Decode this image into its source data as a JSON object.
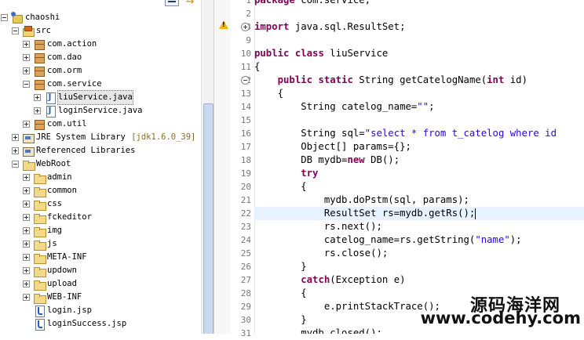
{
  "tree": {
    "items": [
      {
        "label": "chaoshi",
        "icon": "project-icon",
        "exp": "minus"
      },
      {
        "label": "src",
        "icon": "source-folder-icon",
        "exp": "minus"
      },
      {
        "label": "com.action",
        "icon": "package-icon",
        "exp": "plus"
      },
      {
        "label": "com.dao",
        "icon": "package-icon",
        "exp": "plus"
      },
      {
        "label": "com.orm",
        "icon": "package-icon",
        "exp": "plus"
      },
      {
        "label": "com.service",
        "icon": "package-icon",
        "exp": "minus"
      },
      {
        "label": "liuService.java",
        "icon": "java-file-icon",
        "exp": "plus",
        "selected": true
      },
      {
        "label": "loginService.java",
        "icon": "java-file-icon",
        "exp": "plus"
      },
      {
        "label": "com.util",
        "icon": "package-icon",
        "exp": "plus"
      },
      {
        "label": "JRE System Library",
        "suffix": "[jdk1.6.0_39]",
        "icon": "library-icon",
        "exp": "plus"
      },
      {
        "label": "Referenced Libraries",
        "icon": "library-icon",
        "exp": "plus"
      },
      {
        "label": "WebRoot",
        "icon": "folder-icon",
        "exp": "minus"
      },
      {
        "label": "admin",
        "icon": "folder-icon",
        "exp": "plus"
      },
      {
        "label": "common",
        "icon": "folder-icon",
        "exp": "plus"
      },
      {
        "label": "css",
        "icon": "folder-icon",
        "exp": "plus"
      },
      {
        "label": "fckeditor",
        "icon": "folder-icon",
        "exp": "plus"
      },
      {
        "label": "img",
        "icon": "folder-icon",
        "exp": "plus"
      },
      {
        "label": "js",
        "icon": "folder-icon",
        "exp": "plus"
      },
      {
        "label": "META-INF",
        "icon": "folder-icon",
        "exp": "plus"
      },
      {
        "label": "updown",
        "icon": "folder-icon",
        "exp": "plus"
      },
      {
        "label": "upload",
        "icon": "folder-icon",
        "exp": "plus"
      },
      {
        "label": "WEB-INF",
        "icon": "folder-icon",
        "exp": "plus"
      },
      {
        "label": "login.jsp",
        "icon": "jsp-file-icon",
        "exp": "none"
      },
      {
        "label": "loginSuccess.jsp",
        "icon": "jsp-file-icon",
        "exp": "none"
      }
    ]
  },
  "editor": {
    "current_line": 22,
    "lines": [
      {
        "n": "1",
        "fold": "",
        "t": [
          {
            "k": "kw",
            "s": "package"
          },
          {
            "s": " com.service;"
          }
        ]
      },
      {
        "n": "2",
        "fold": "",
        "t": []
      },
      {
        "n": "3",
        "fold": "plus",
        "t": [
          {
            "k": "kw",
            "s": "import"
          },
          {
            "s": " java.sql.ResultSet;"
          }
        ]
      },
      {
        "n": "9",
        "fold": "",
        "t": []
      },
      {
        "n": "10",
        "fold": "",
        "t": [
          {
            "k": "kw",
            "s": "public"
          },
          {
            "s": " "
          },
          {
            "k": "kw",
            "s": "class"
          },
          {
            "s": " liuService"
          }
        ]
      },
      {
        "n": "11",
        "fold": "",
        "t": [
          {
            "s": "{"
          }
        ]
      },
      {
        "n": "12",
        "fold": "minus",
        "t": [
          {
            "s": "    "
          },
          {
            "k": "kw",
            "s": "public"
          },
          {
            "s": " "
          },
          {
            "k": "kw",
            "s": "static"
          },
          {
            "s": " String getCatelogName("
          },
          {
            "k": "kw",
            "s": "int"
          },
          {
            "s": " id)"
          }
        ]
      },
      {
        "n": "13",
        "fold": "",
        "t": [
          {
            "s": "    {"
          }
        ]
      },
      {
        "n": "14",
        "fold": "",
        "t": [
          {
            "s": "        String catelog_name="
          },
          {
            "k": "st",
            "s": "\"\""
          },
          {
            "s": ";"
          }
        ]
      },
      {
        "n": "15",
        "fold": "",
        "t": []
      },
      {
        "n": "16",
        "fold": "",
        "t": [
          {
            "s": "        String sql="
          },
          {
            "k": "st",
            "s": "\"select * from t_catelog where id"
          }
        ]
      },
      {
        "n": "17",
        "fold": "",
        "t": [
          {
            "s": "        Object[] params={};"
          }
        ]
      },
      {
        "n": "18",
        "fold": "",
        "t": [
          {
            "s": "        DB mydb="
          },
          {
            "k": "kw",
            "s": "new"
          },
          {
            "s": " DB();"
          }
        ]
      },
      {
        "n": "19",
        "fold": "",
        "t": [
          {
            "s": "        "
          },
          {
            "k": "kw",
            "s": "try"
          }
        ]
      },
      {
        "n": "20",
        "fold": "",
        "t": [
          {
            "s": "        {"
          }
        ]
      },
      {
        "n": "21",
        "fold": "",
        "t": [
          {
            "s": "            mydb.doPstm(sql, params);"
          }
        ]
      },
      {
        "n": "22",
        "fold": "",
        "t": [
          {
            "s": "            ResultSet rs=mydb.getRs();"
          }
        ]
      },
      {
        "n": "23",
        "fold": "",
        "t": [
          {
            "s": "            rs.next();"
          }
        ]
      },
      {
        "n": "24",
        "fold": "",
        "t": [
          {
            "s": "            catelog_name=rs.getString("
          },
          {
            "k": "st",
            "s": "\"name\""
          },
          {
            "s": ");"
          }
        ]
      },
      {
        "n": "25",
        "fold": "",
        "t": [
          {
            "s": "            rs.close();"
          }
        ]
      },
      {
        "n": "26",
        "fold": "",
        "t": [
          {
            "s": "        }"
          }
        ]
      },
      {
        "n": "27",
        "fold": "",
        "t": [
          {
            "s": "        "
          },
          {
            "k": "kw",
            "s": "catch"
          },
          {
            "s": "(Exception e)"
          }
        ]
      },
      {
        "n": "28",
        "fold": "",
        "t": [
          {
            "s": "        {"
          }
        ]
      },
      {
        "n": "29",
        "fold": "",
        "t": [
          {
            "s": "            e.printStackTrace();"
          }
        ]
      },
      {
        "n": "30",
        "fold": "",
        "t": [
          {
            "s": "        }"
          }
        ]
      },
      {
        "n": "31",
        "fold": "",
        "t": [
          {
            "s": "        mydb.closed();"
          }
        ]
      }
    ]
  },
  "watermark": {
    "cn": "源码海洋网",
    "url": "www.codehy.com"
  }
}
